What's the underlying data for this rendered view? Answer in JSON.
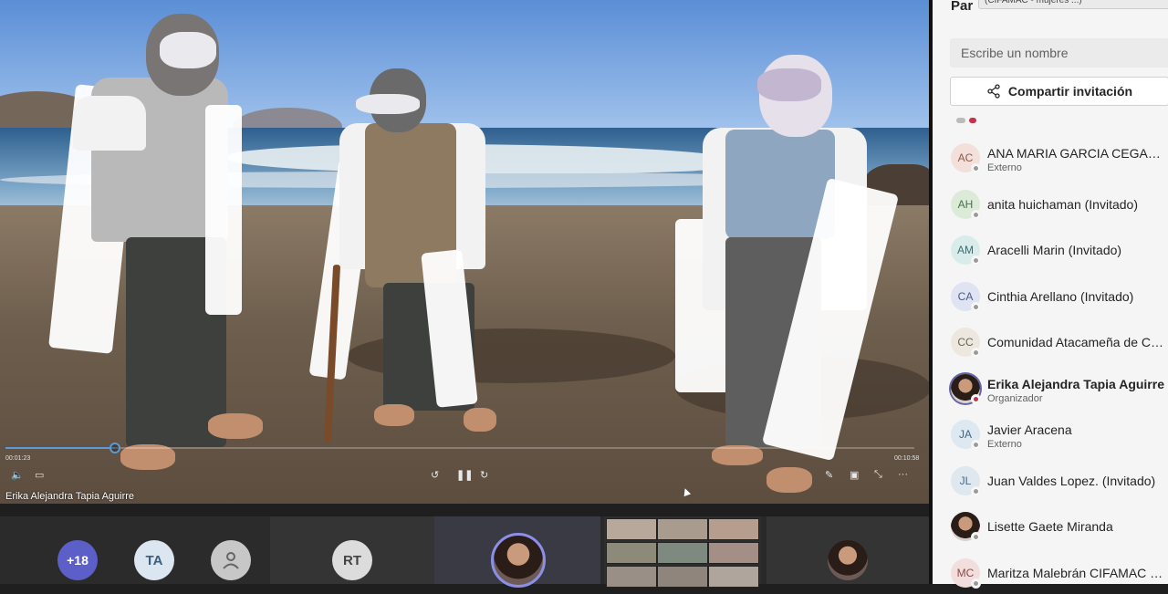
{
  "video": {
    "presenter_label": "Erika Alejandra Tapia Aguirre",
    "time_current": "00:01:23",
    "time_total": "00:10:58",
    "progress": 0.12
  },
  "gallery": {
    "more_count": "+18",
    "ta_initials": "TA",
    "rt_initials": "RT"
  },
  "panel": {
    "title": "Par",
    "tooltip": "(CIFAMAC - mujeres ...)",
    "search_placeholder": "Escribe un nombre",
    "share_label": "Compartir invitación",
    "participants": [
      {
        "initials": "AC",
        "name": "ANA MARIA GARCIA CEGARRA",
        "sub": "Externo",
        "bg": "#f3e0da",
        "fg": "#8a5a4a",
        "bold": false
      },
      {
        "initials": "AH",
        "name": "anita huichaman (Invitado)",
        "sub": "",
        "bg": "#dcebd8",
        "fg": "#49704a",
        "bold": false
      },
      {
        "initials": "AM",
        "name": "Aracelli Marin (Invitado)",
        "sub": "",
        "bg": "#d9ecec",
        "fg": "#3c6c6c",
        "bold": false
      },
      {
        "initials": "CA",
        "name": "Cinthia Arellano (Invitado)",
        "sub": "",
        "bg": "#dfe3f2",
        "fg": "#4c5a8a",
        "bold": false
      },
      {
        "initials": "CC",
        "name": "Comunidad Atacameña de Co...",
        "sub": "",
        "bg": "#ece8e0",
        "fg": "#6c6250",
        "bold": false
      },
      {
        "initials": "",
        "name": "Erika Alejandra Tapia Aguirre",
        "sub": "Organizador",
        "bg": "#6a4d44",
        "fg": "#fff",
        "bold": true,
        "photo": true
      },
      {
        "initials": "JA",
        "name": "Javier Aracena",
        "sub": "Externo",
        "bg": "#dde8f0",
        "fg": "#3d6585",
        "bold": false
      },
      {
        "initials": "JL",
        "name": "Juan Valdes Lopez. (Invitado)",
        "sub": "",
        "bg": "#dfe7ef",
        "fg": "#4a6a8a",
        "bold": false
      },
      {
        "initials": "",
        "name": "Lisette Gaete Miranda",
        "sub": "",
        "bg": "#6a4d44",
        "fg": "#fff",
        "bold": false,
        "photo": true
      },
      {
        "initials": "MC",
        "name": "Maritza Malebrán CIFAMAC (I...",
        "sub": "",
        "bg": "#f3dede",
        "fg": "#8a4a4a",
        "bold": false
      }
    ]
  },
  "colors": {
    "accent": "#6264a7",
    "progress": "#5b9bd5"
  }
}
